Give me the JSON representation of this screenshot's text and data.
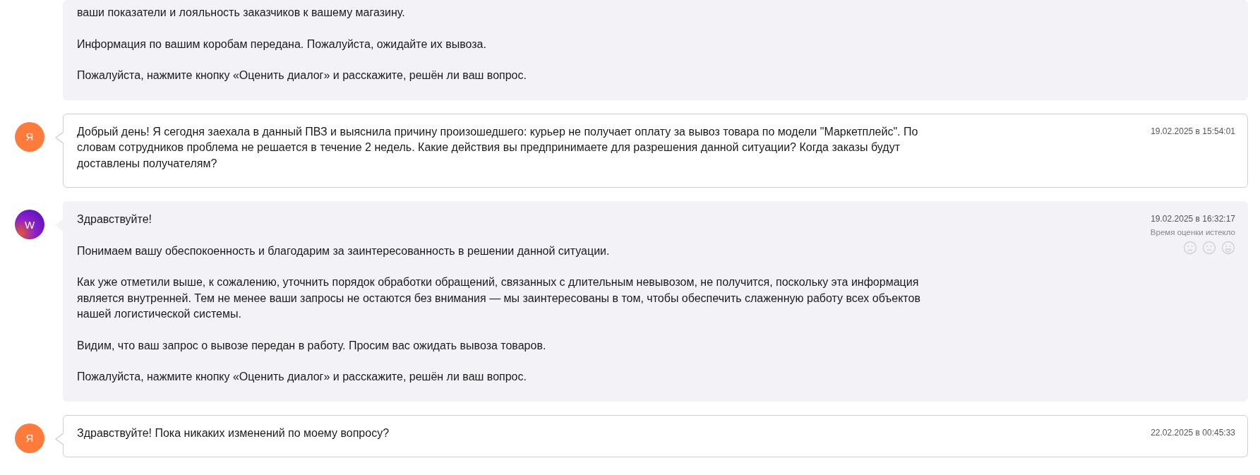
{
  "messages": [
    {
      "kind": "support",
      "paragraphs": [
        "ваши показатели и лояльность заказчиков к вашему магазину.",
        "Информация по вашим коробам передана. Пожалуйста, ожидайте их вывоза.",
        "Пожалуйста, нажмите кнопку «Оценить диалог» и расскажите, решён ли ваш вопрос."
      ]
    },
    {
      "kind": "user",
      "avatar": "Я",
      "timestamp": "19.02.2025 в 15:54:01",
      "paragraphs": [
        "Добрый день! Я сегодня заехала в данный ПВЗ и выяснила причину произошедшего: курьер не получает оплату за вывоз товара по модели \"Маркетплейс\". По словам сотрудников проблема не решается в течение 2 недель. Какие действия вы предпринимаете для разрешения данной ситуации? Когда заказы будут доставлены получателям?"
      ]
    },
    {
      "kind": "support",
      "avatar": "W",
      "timestamp": "19.02.2025 в 16:32:17",
      "rating": {
        "note": "Время оценки истекло",
        "disabled": true
      },
      "paragraphs": [
        "Здравствуйте!",
        "Понимаем вашу обеспокоенность и благодарим за заинтересованность в решении данной ситуации.",
        "Как уже отметили выше, к сожалению, уточнить порядок обработки обращений, связанных с длительным невывозом, не получится, поскольку эта информация является внутренней. Тем не менее ваши запросы не остаются без внимания — мы заинтересованы в том, чтобы обеспечить слаженную работу всех объектов нашей логистической системы.",
        "Видим, что ваш запрос о вывозе передан в работу. Просим вас ожидать вывоза товаров.",
        "Пожалуйста, нажмите кнопку «Оценить диалог» и расскажите, решён ли ваш вопрос."
      ]
    },
    {
      "kind": "user",
      "avatar": "Я",
      "timestamp": "22.02.2025 в 00:45:33",
      "paragraphs": [
        "Здравствуйте! Пока никаких изменений по моему вопросу?"
      ]
    }
  ]
}
